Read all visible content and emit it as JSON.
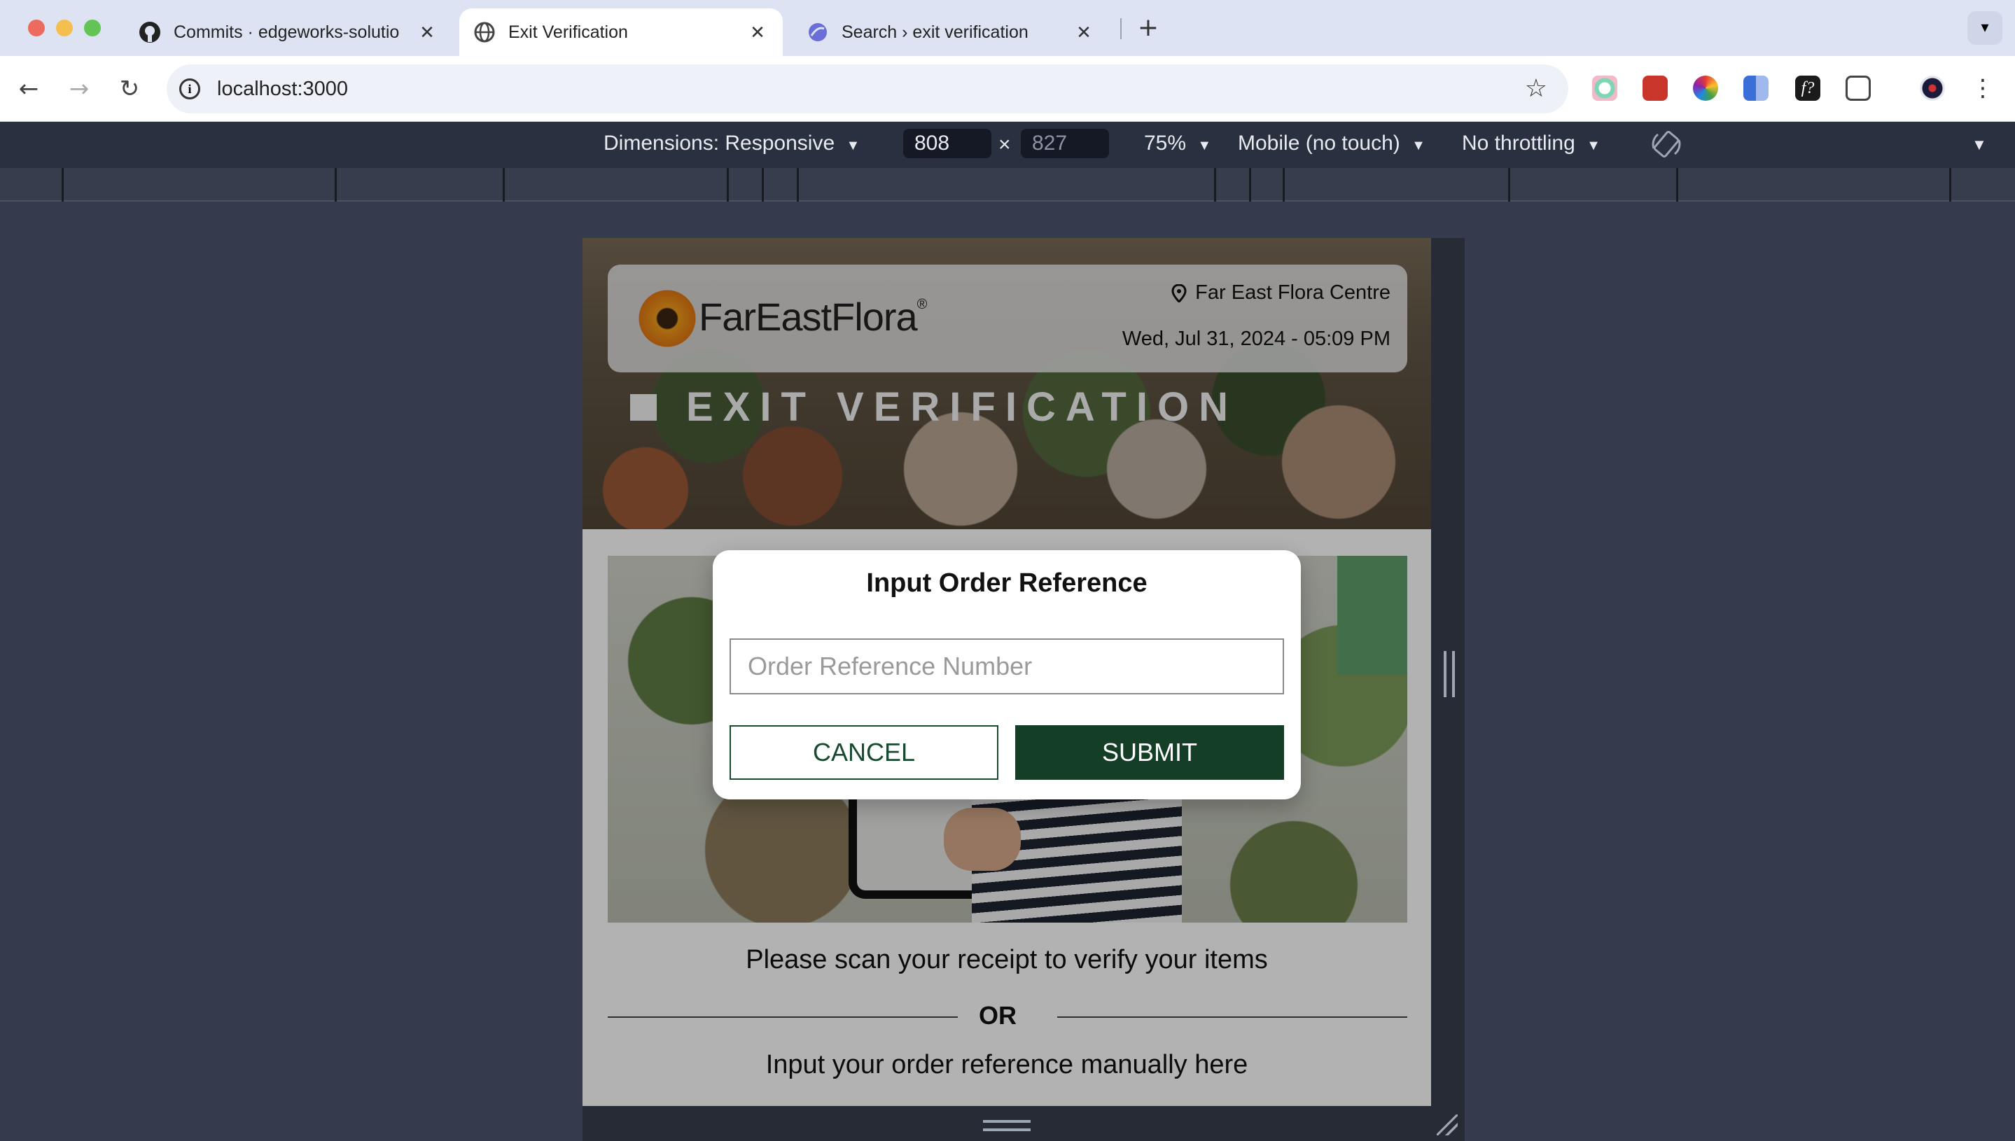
{
  "browser": {
    "tabs": [
      {
        "title": "Commits · edgeworks-solutio",
        "icon": "github-icon",
        "close": "✕"
      },
      {
        "title": "Exit Verification",
        "icon": "globe-icon",
        "close": "✕"
      },
      {
        "title": "Search › exit verification",
        "icon": "search-app-icon",
        "close": "✕"
      }
    ],
    "new_tab": "+",
    "url": "localhost:3000"
  },
  "devtools": {
    "dimensions_label": "Dimensions: Responsive",
    "width": "808",
    "times": "×",
    "height": "827",
    "zoom": "75%",
    "device": "Mobile (no touch)",
    "throttling": "No throttling"
  },
  "app": {
    "brand": "FarEastFlora",
    "brand_mark": "®",
    "location": "Far East Flora Centre",
    "datetime": "Wed, Jul 31, 2024 - 05:09 PM",
    "page_title": "EXIT VERIFICATION",
    "scan_instruction": "Please scan your receipt to verify your items",
    "or_label": "OR",
    "manual_instruction": "Input your order reference manually here"
  },
  "modal": {
    "title": "Input Order Reference",
    "input_value": "",
    "input_placeholder": "Order Reference Number",
    "cancel_label": "CANCEL",
    "submit_label": "SUBMIT"
  },
  "colors": {
    "brand_dark_green": "#153e27",
    "chrome_tabbar": "#dde3f2",
    "devtools_bg": "#343b4c"
  }
}
